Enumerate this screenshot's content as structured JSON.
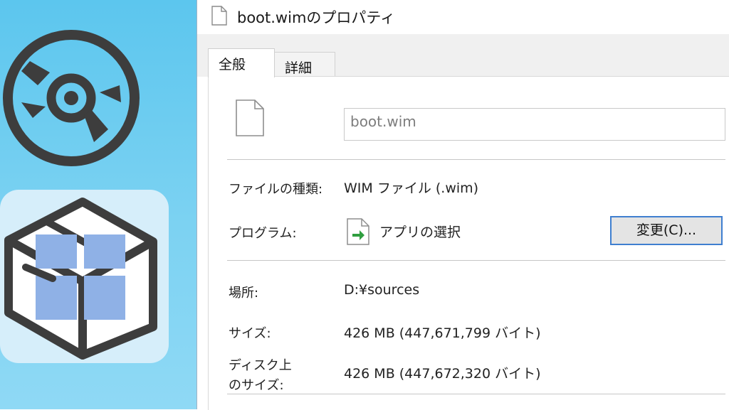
{
  "window": {
    "title": "boot.wimのプロパティ"
  },
  "tabs": [
    {
      "label": "全般",
      "active": true
    },
    {
      "label": "詳細",
      "active": false
    }
  ],
  "general": {
    "filename_value": "boot.wim",
    "file_type_label": "ファイルの種類:",
    "file_type_value": "WIM ファイル (.wim)",
    "program_label": "プログラム:",
    "program_value": "アプリの選択",
    "change_button_label": "変更(C)...",
    "location_label": "場所:",
    "location_value": "D:¥sources",
    "size_label": "サイズ:",
    "size_value": "426 MB (447,671,799 バイト)",
    "size_on_disk_label_line1": "ディスク上",
    "size_on_disk_label_line2": "のサイズ:",
    "size_on_disk_value": "426 MB (447,672,320 バイト)"
  },
  "icons": {
    "title": "document-icon",
    "file": "file-icon",
    "program": "app-select-icon",
    "left_top": "disc-icon",
    "left_bottom": "package-icon"
  },
  "colors": {
    "left_panel": "#6ccdf0",
    "icon_stroke": "#3d3d3d",
    "pane_blue": "#8fb1e6",
    "button_border": "#3f7fd0",
    "arrow_green": "#2f9e3f"
  }
}
